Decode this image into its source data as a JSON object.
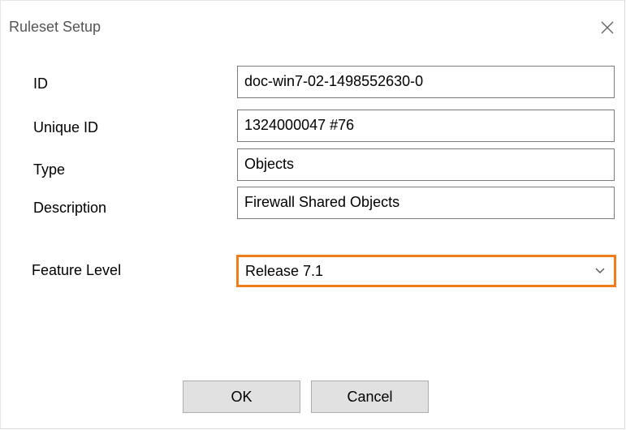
{
  "dialog": {
    "title": "Ruleset Setup",
    "close_icon": "close-icon"
  },
  "fields": {
    "id": {
      "label": "ID",
      "value": "doc-win7-02-1498552630-0"
    },
    "unique_id": {
      "label": "Unique ID",
      "value": "1324000047 #76"
    },
    "type": {
      "label": "Type",
      "value": "Objects"
    },
    "description": {
      "label": "Description",
      "value": "Firewall Shared Objects"
    }
  },
  "feature_level": {
    "label": "Feature Level",
    "selected": "Release 7.1",
    "icon": "chevron-down-icon"
  },
  "buttons": {
    "ok": "OK",
    "cancel": "Cancel"
  },
  "colors": {
    "focus_border": "#f07c1a",
    "button_bg": "#e1e1e1",
    "title_text": "#555555"
  }
}
